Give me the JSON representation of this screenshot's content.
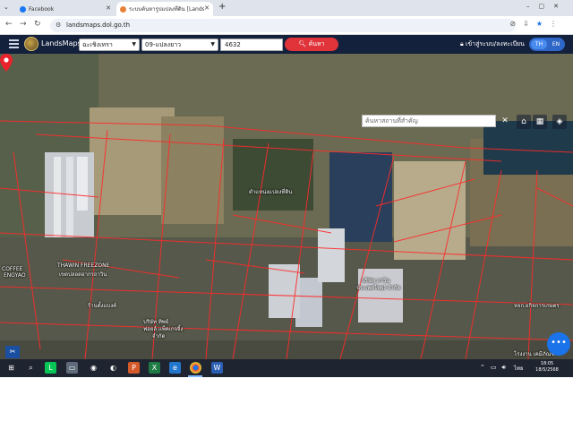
{
  "browser": {
    "tabs": [
      {
        "label": "Facebook",
        "favicon_color": "#1877f2"
      },
      {
        "label": "ระบบค้นหารูปแปลงที่ดิน [LandsMa",
        "favicon_color": "#e8803a"
      }
    ],
    "new_tab_icon": "plus-icon",
    "url": "landsmaps.dol.go.th"
  },
  "app": {
    "brand": "LandsMaps",
    "district_select": "ฉะเชิงเทรา",
    "sheet_select": "09-แปลงยาว",
    "parcel_number": "4632",
    "search_label": "ค้นหา",
    "login_label": "เข้าสู่ระบบ/ลงทะเบียน",
    "lang_th": "TH",
    "lang_en": "EN",
    "place_search_placeholder": "ค้นหาสถานที่สำคัญ",
    "colors": {
      "header": "#14213d",
      "search": "#e0333a",
      "parcel_lines": "#ff2a2a",
      "pin": "#e8232d"
    }
  },
  "map": {
    "pin_label": "ตำแหน่งแปลงที่ดิน",
    "labels": {
      "coffee": "COFFEE",
      "coffee2": "ENGYAO",
      "freezone": "THAWIN FREEZONE",
      "freezone2": "เขตปลอดอากรถาวิน",
      "store": "ร้านตั้งแบงค์",
      "factory": "บริษัท ถาวิน",
      "factory2": "ประเทศไทย) จำกัด",
      "south1": "บริษัท ทิพย์",
      "south2": "ฟอยล์ แพ็คเกจจิ้ง",
      "south3": "จำกัด",
      "east1": "หจก.ยกิจการเกษตร",
      "east2": "โรงงาน เคมีภัณฑ์"
    }
  },
  "taskbar": {
    "tray_lang": "ไทย",
    "time": "18:05",
    "date": "18/5/2568"
  }
}
